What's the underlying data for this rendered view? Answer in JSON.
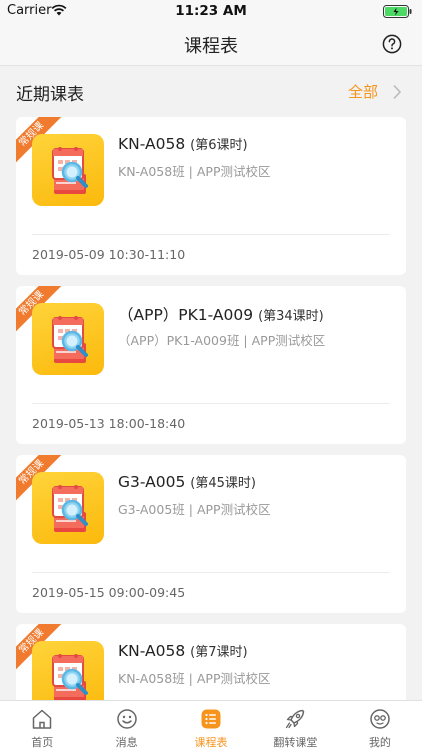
{
  "status": {
    "carrier": "Carrier",
    "time": "11:23 AM"
  },
  "nav": {
    "title": "课程表"
  },
  "section": {
    "title": "近期课表",
    "all_label": "全部"
  },
  "cards": [
    {
      "ribbon": "常规课",
      "name": "KN-A058",
      "lesson": "(第6课时)",
      "sub": "KN-A058班 | APP测试校区",
      "time": "2019-05-09 10:30-11:10"
    },
    {
      "ribbon": "常规课",
      "name": "（APP）PK1-A009",
      "lesson": "(第34课时)",
      "sub": "（APP）PK1-A009班 | APP测试校区",
      "time": "2019-05-13 18:00-18:40"
    },
    {
      "ribbon": "常规课",
      "name": "G3-A005",
      "lesson": "(第45课时)",
      "sub": "G3-A005班 | APP测试校区",
      "time": "2019-05-15 09:00-09:45"
    },
    {
      "ribbon": "常规课",
      "name": "KN-A058",
      "lesson": "(第7课时)",
      "sub": "KN-A058班 | APP测试校区",
      "time": ""
    }
  ],
  "tabs": [
    {
      "label": "首页",
      "icon": "home-icon"
    },
    {
      "label": "消息",
      "icon": "message-icon"
    },
    {
      "label": "课程表",
      "icon": "schedule-icon",
      "active": true
    },
    {
      "label": "翻转课堂",
      "icon": "rocket-icon"
    },
    {
      "label": "我的",
      "icon": "profile-icon"
    }
  ],
  "colors": {
    "accent": "#f7941d",
    "ribbon": "#f07b2e",
    "icon_bg": "#fbc21a"
  }
}
